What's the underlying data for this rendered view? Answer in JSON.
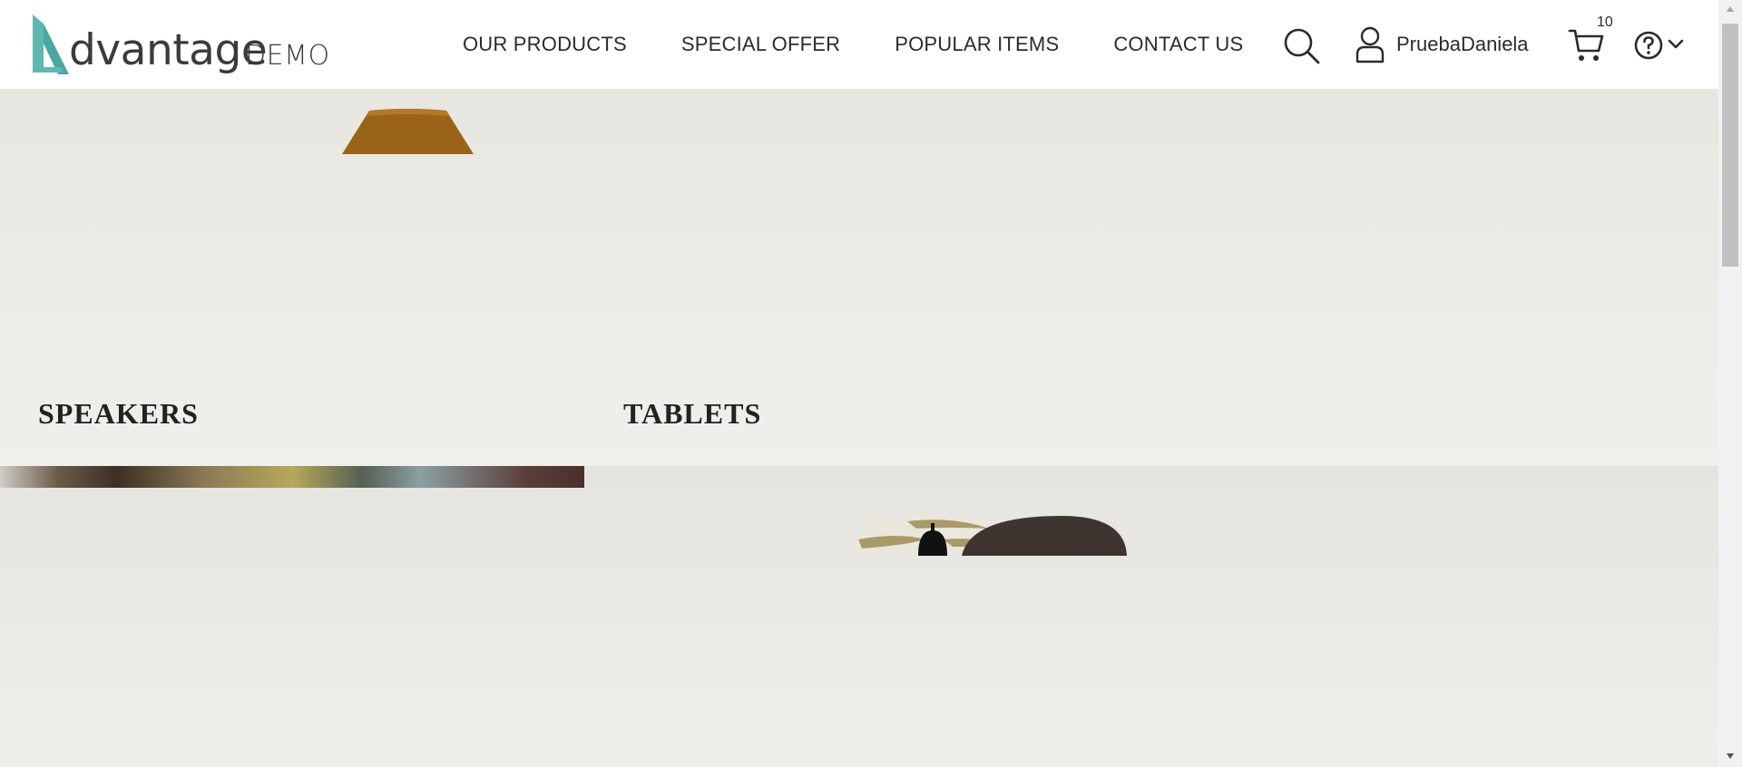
{
  "logo": {
    "wordmark": "dvantage",
    "suffix": "DEMO",
    "accent_color": "#5fb7b2"
  },
  "nav": {
    "items": [
      {
        "label": "OUR PRODUCTS"
      },
      {
        "label": "SPECIAL OFFER"
      },
      {
        "label": "POPULAR ITEMS"
      },
      {
        "label": "CONTACT US"
      }
    ]
  },
  "header": {
    "search_icon": "search-icon",
    "user": {
      "icon": "user-icon",
      "name": "PruebaDaniela"
    },
    "cart": {
      "icon": "cart-icon",
      "count": "10"
    },
    "help": {
      "icon": "help-icon",
      "menu_icon": "chevron-down-icon"
    }
  },
  "categories": [
    {
      "label": "SPEAKERS"
    },
    {
      "label": "TABLETS"
    }
  ],
  "colors": {
    "header_bg": "#ffffff",
    "page_bg": "#ebe9e4",
    "lamp": "#9a6418"
  }
}
